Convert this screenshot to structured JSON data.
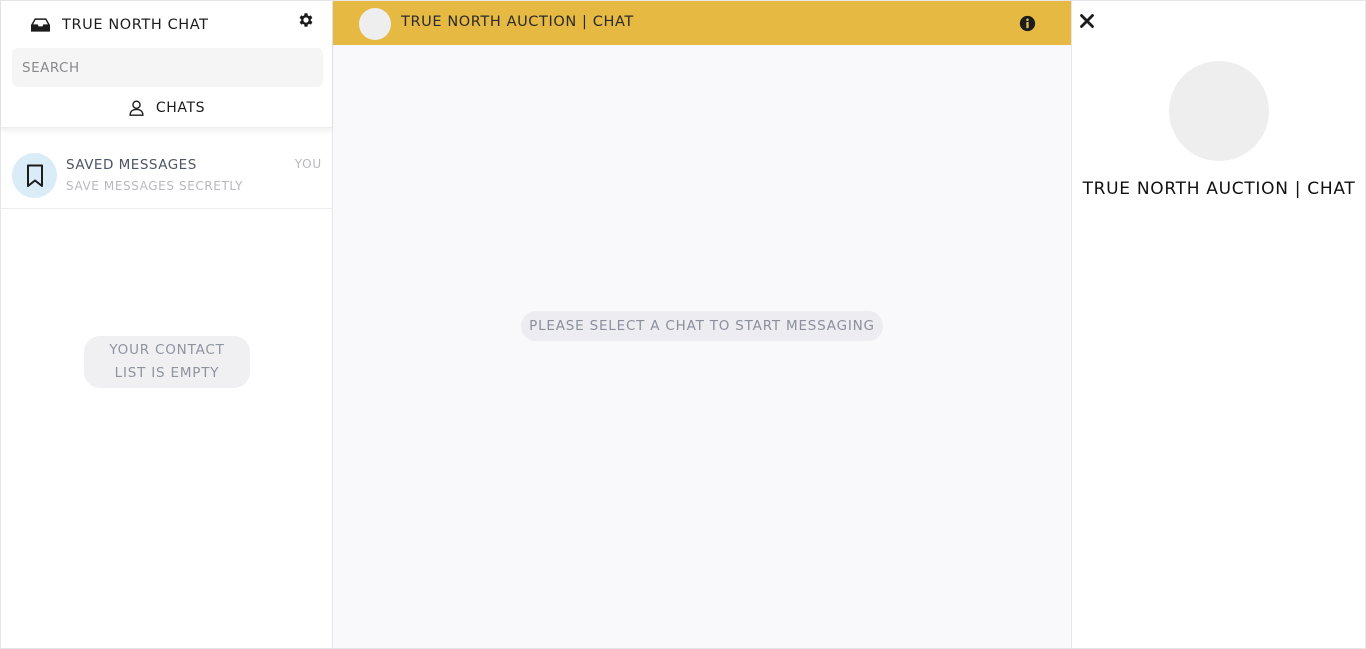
{
  "sidebar": {
    "brand": {
      "title": "TRUE NORTH CHAT",
      "icon": "inbox-icon"
    },
    "settings_icon": "gear-icon",
    "search": {
      "placeholder": "SEARCH",
      "value": ""
    },
    "tabs": [
      {
        "label": "CHATS",
        "icon": "person-icon"
      }
    ],
    "chats": [
      {
        "name": "SAVED MESSAGES",
        "preview": "SAVE MESSAGES SECRETLY",
        "meta": "YOU",
        "icon": "bookmark-icon"
      }
    ],
    "empty_contacts": "YOUR CONTACT LIST IS EMPTY"
  },
  "main": {
    "header": {
      "title": "TRUE NORTH AUCTION | CHAT",
      "info_icon": "info-icon"
    },
    "placeholder": "PLEASE SELECT A CHAT TO START MESSAGING"
  },
  "info_panel": {
    "close_icon": "close-icon",
    "name": "TRUE NORTH AUCTION | CHAT"
  },
  "colors": {
    "header_accent": "#e6b943",
    "saved_avatar_bg": "#d9ecf8",
    "main_bg": "#f9f9fc"
  }
}
